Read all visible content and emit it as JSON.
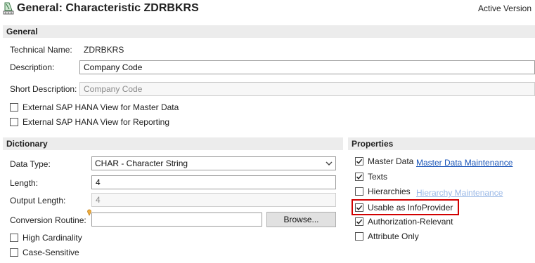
{
  "header": {
    "title": "General: Characteristic ZDRBKRS",
    "version": "Active Version",
    "icon": "characteristic-icon"
  },
  "general": {
    "section_title": "General",
    "technical_name_label": "Technical Name:",
    "technical_name_value": "ZDRBKRS",
    "description_label": "Description:",
    "description_value": "Company Code",
    "short_description_label": "Short Description:",
    "short_description_value": "Company Code",
    "hana_master_data_label": "External SAP HANA View for Master Data",
    "hana_master_data_checked": false,
    "hana_reporting_label": "External SAP HANA View for Reporting",
    "hana_reporting_checked": false
  },
  "dictionary": {
    "section_title": "Dictionary",
    "data_type_label": "Data Type:",
    "data_type_value": "CHAR - Character String",
    "length_label": "Length:",
    "length_value": "4",
    "output_length_label": "Output Length:",
    "output_length_value": "4",
    "conversion_routine_label": "Conversion Routine:",
    "conversion_routine_value": "",
    "browse_label": "Browse...",
    "high_cardinality_label": "High Cardinality",
    "high_cardinality_checked": false,
    "case_sensitive_label": "Case-Sensitive",
    "case_sensitive_checked": false
  },
  "properties": {
    "section_title": "Properties",
    "items": [
      {
        "label": "Master Data",
        "checked": true,
        "link": "Master Data Maintenance",
        "link_enabled": true
      },
      {
        "label": "Texts",
        "checked": true
      },
      {
        "label": "Hierarchies",
        "checked": false,
        "link": "Hierarchy Maintenance",
        "link_enabled": false
      },
      {
        "label": "Usable as InfoProvider",
        "checked": true,
        "highlighted": true
      },
      {
        "label": "Authorization-Relevant",
        "checked": true
      },
      {
        "label": "Attribute Only",
        "checked": false
      }
    ]
  },
  "colors": {
    "highlight": "#d10000",
    "link": "#1a55b8",
    "link_disabled": "#9ab8e6",
    "section_bg": "#ececec"
  }
}
